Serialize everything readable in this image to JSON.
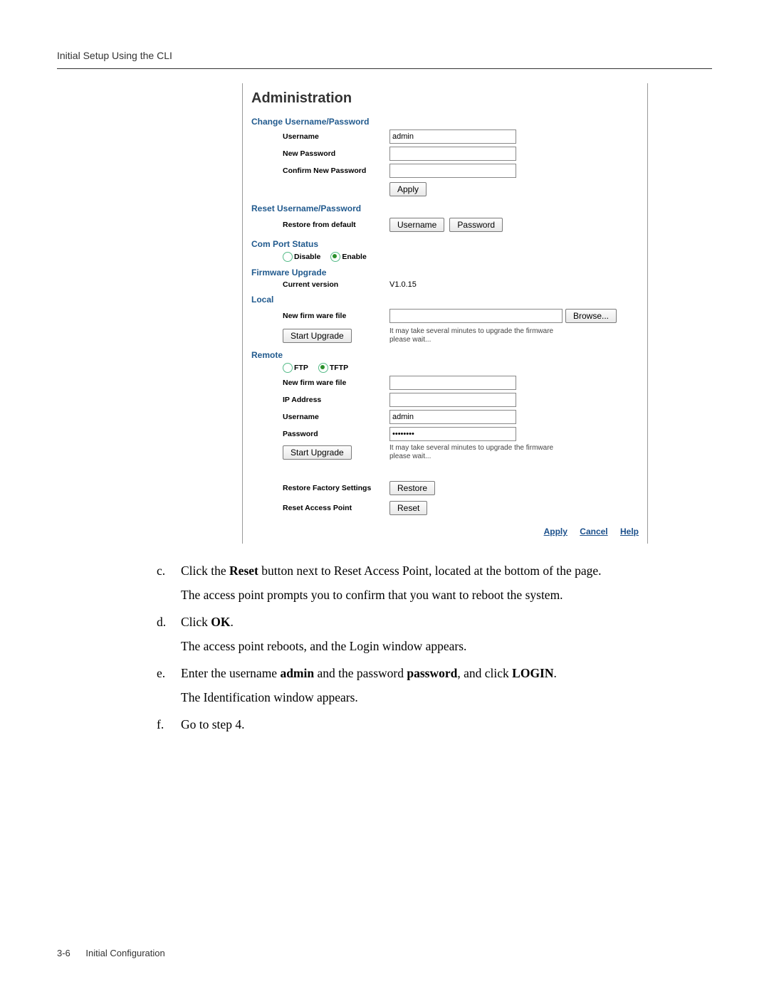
{
  "header": {
    "running": "Initial Setup Using the CLI"
  },
  "shot": {
    "title": "Administration",
    "change_pw": {
      "heading": "Change Username/Password",
      "username_label": "Username",
      "username_value": "admin",
      "new_pw_label": "New Password",
      "confirm_pw_label": "Confirm New Password",
      "apply_btn": "Apply"
    },
    "reset_pw": {
      "heading": "Reset Username/Password",
      "restore_label": "Restore from default",
      "username_btn": "Username",
      "password_btn": "Password"
    },
    "com": {
      "heading": "Com Port Status",
      "disable": "Disable",
      "enable": "Enable"
    },
    "fw": {
      "heading": "Firmware Upgrade",
      "cur_ver_label": "Current version",
      "cur_ver_value": "V1.0.15"
    },
    "local": {
      "heading": "Local",
      "file_label": "New firm ware file",
      "browse": "Browse...",
      "start": "Start Upgrade",
      "hint": "It may take several minutes to upgrade the firmware please wait..."
    },
    "remote": {
      "heading": "Remote",
      "ftp": "FTP",
      "tftp": "TFTP",
      "file_label": "New firm ware file",
      "ip_label": "IP Address",
      "user_label": "Username",
      "user_value": "admin",
      "pw_label": "Password",
      "pw_value": "••••••••",
      "start": "Start Upgrade",
      "hint": "It may take several minutes to upgrade the firmware please wait..."
    },
    "restore": {
      "factory_label": "Restore Factory Settings",
      "factory_btn": "Restore",
      "reset_ap_label": "Reset Access Point",
      "reset_ap_btn": "Reset"
    },
    "footer": {
      "apply": "Apply",
      "cancel": "Cancel",
      "help": "Help"
    }
  },
  "steps": {
    "c": {
      "line1a": "Click the ",
      "bold1": "Reset",
      "line1b": " button next to Reset Access Point, located at the bottom of the page.",
      "line2": "The access point prompts you to confirm that you want to reboot the system."
    },
    "d": {
      "line1a": "Click ",
      "bold1": "OK",
      "line1b": ".",
      "line2": "The access point reboots, and the Login window appears."
    },
    "e": {
      "line1a": "Enter the username ",
      "bold1": "admin",
      "line1b": " and the password ",
      "bold2": "password",
      "line1c": ", and click ",
      "bold3": "LOGIN",
      "line1d": ".",
      "line2": "The Identification window appears."
    },
    "f": {
      "line1": "Go to step 4."
    }
  },
  "footer": {
    "page_num": "3-6",
    "section": "Initial Configuration"
  }
}
